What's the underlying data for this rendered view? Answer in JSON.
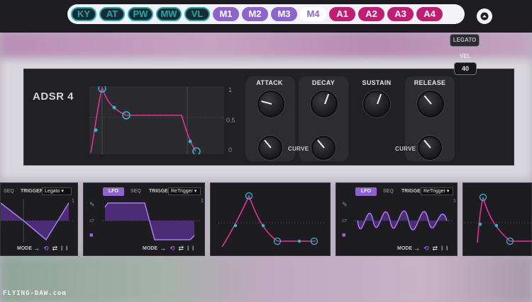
{
  "colors": {
    "cyan": "#19aab3",
    "macro": "#8c64cc",
    "aux": "#c01e72",
    "pink": "#e0338f",
    "panel": "#212125"
  },
  "tabs": [
    {
      "label": "KY",
      "kind": "mod"
    },
    {
      "label": "AT",
      "kind": "mod"
    },
    {
      "label": "PW",
      "kind": "mod"
    },
    {
      "label": "MW",
      "kind": "mod"
    },
    {
      "label": "VL",
      "kind": "mod"
    },
    {
      "label": "M1",
      "kind": "macro"
    },
    {
      "label": "M2",
      "kind": "macro"
    },
    {
      "label": "M3",
      "kind": "macro"
    },
    {
      "label": "M4",
      "kind": "macro",
      "active": true
    },
    {
      "label": "A1",
      "kind": "aux"
    },
    {
      "label": "A2",
      "kind": "aux"
    },
    {
      "label": "A3",
      "kind": "aux"
    },
    {
      "label": "A4",
      "kind": "aux"
    }
  ],
  "collapse_icon": "chevron-up-icon",
  "adsr": {
    "title": "ADSR 4",
    "graph_ticks": [
      "1",
      "0.5",
      "0"
    ],
    "knobs": {
      "attack": "ATTACK",
      "decay": "DECAY",
      "sustain": "SUSTAIN",
      "release": "RELEASE"
    },
    "curve_label": "CURVE",
    "legato": "LEGATO",
    "vel_label": "VEL",
    "vel_value": "40"
  },
  "cards": {
    "seq_label": "SEQ",
    "lfo_label": "LFO",
    "trigger_label": "TRIGGER",
    "mode_label": "MODE",
    "card1_trigger": "Legato",
    "card2_trigger": "ReTrigger",
    "card4_trigger": "ReTrigger"
  },
  "watermark": "FLYING-DAW.com"
}
